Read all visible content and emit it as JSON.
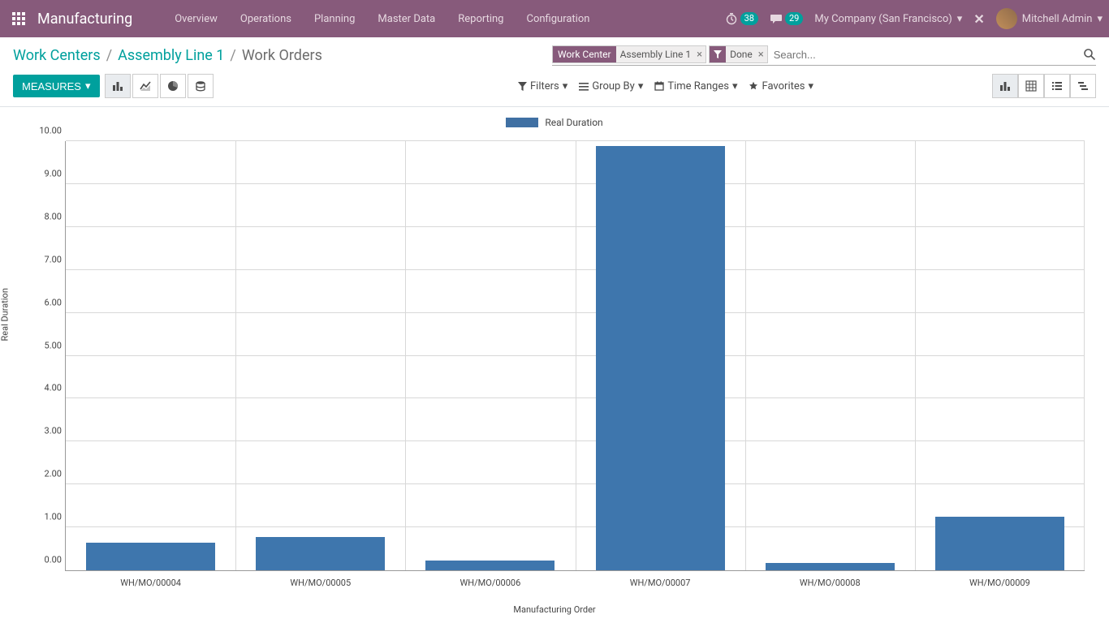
{
  "navbar": {
    "app_name": "Manufacturing",
    "menu": [
      "Overview",
      "Operations",
      "Planning",
      "Master Data",
      "Reporting",
      "Configuration"
    ],
    "timer_badge": "38",
    "chat_badge": "29",
    "company": "My Company (San Francisco)",
    "user": "Mitchell Admin"
  },
  "breadcrumb": {
    "l0": "Work Centers",
    "l1": "Assembly Line 1",
    "l2": "Work Orders"
  },
  "search": {
    "facet1_label": "Work Center",
    "facet1_value": "Assembly Line 1",
    "facet2_value": "Done",
    "placeholder": "Search..."
  },
  "controls": {
    "measures": "MEASURES",
    "filters": "Filters",
    "groupby": "Group By",
    "timeranges": "Time Ranges",
    "favorites": "Favorites"
  },
  "chart_data": {
    "type": "bar",
    "title": "",
    "legend": "Real Duration",
    "xlabel": "Manufacturing Order",
    "ylabel": "Real Duration",
    "ylim": [
      0,
      10
    ],
    "yticks": [
      "0.00",
      "1.00",
      "2.00",
      "3.00",
      "4.00",
      "5.00",
      "6.00",
      "7.00",
      "8.00",
      "9.00",
      "10.00"
    ],
    "categories": [
      "WH/MO/00004",
      "WH/MO/00005",
      "WH/MO/00006",
      "WH/MO/00007",
      "WH/MO/00008",
      "WH/MO/00009"
    ],
    "values": [
      0.65,
      0.77,
      0.22,
      9.88,
      0.17,
      1.25
    ]
  },
  "colors": {
    "bar": "#3e76ad",
    "teal": "#00a09d",
    "purple": "#875a7b"
  }
}
